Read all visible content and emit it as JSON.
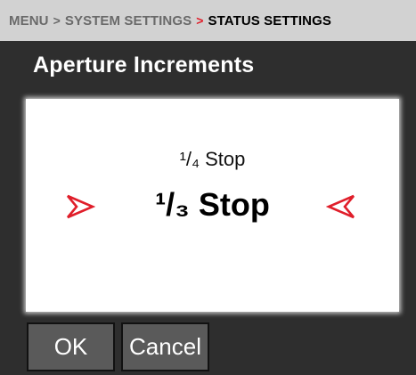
{
  "breadcrumb": {
    "items": [
      "MENU",
      "SYSTEM SETTINGS",
      "STATUS SETTINGS"
    ],
    "separator": ">"
  },
  "title": "Aperture Increments",
  "selector": {
    "previous_option": "¹/₄ Stop",
    "current_option": "¹/₃ Stop",
    "left_arrow_icon": "chevron-right-outline",
    "right_arrow_icon": "chevron-left-outline"
  },
  "buttons": {
    "ok_label": "OK",
    "cancel_label": "Cancel"
  },
  "colors": {
    "accent": "#e01e2a",
    "background": "#2e2e2e",
    "breadcrumb_bg": "#d2d2d2",
    "button_bg": "#5a5a5a"
  }
}
